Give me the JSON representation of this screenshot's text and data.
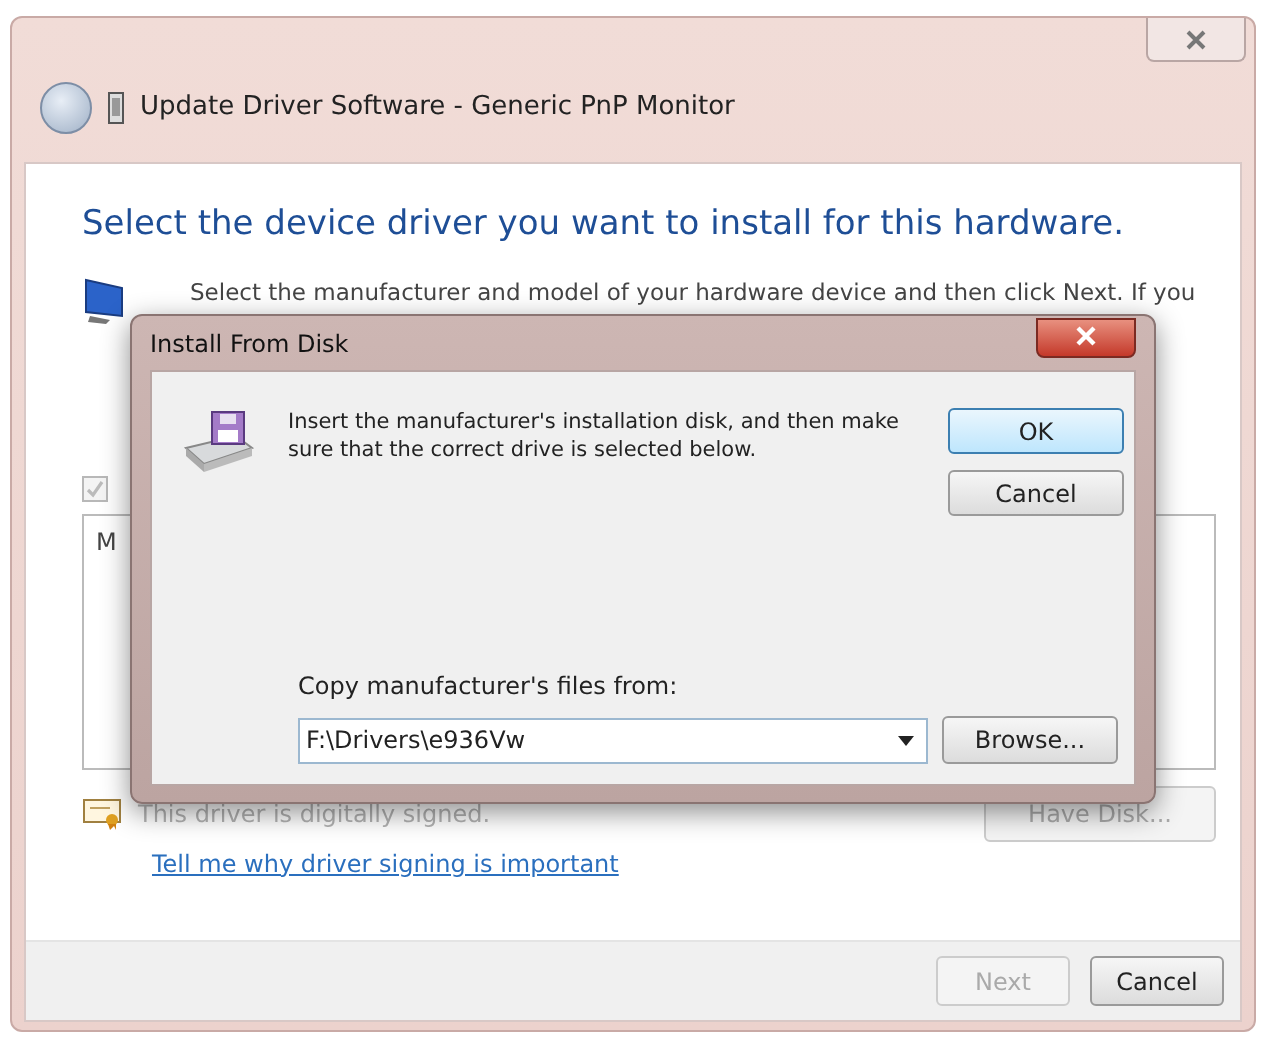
{
  "window": {
    "title": "Update Driver Software - Generic PnP Monitor"
  },
  "heading": "Select the device driver you want to install for this hardware.",
  "instruction": "Select the manufacturer and model of your hardware device and then click Next. If you",
  "show_compatible": {
    "checked": true,
    "disabled": true
  },
  "list": {
    "column_1": "M"
  },
  "signing": {
    "text": "This driver is digitally signed.",
    "disabled": true
  },
  "link": "Tell me why driver signing is important",
  "have_disk": {
    "label": "Have Disk...",
    "disabled": true
  },
  "buttons": [
    {
      "label": "Next",
      "disabled": true
    },
    {
      "label": "Cancel",
      "disabled": false
    }
  ],
  "dialog": {
    "title": "Install From Disk",
    "message": "Insert the manufacturer's installation disk, and then make sure that the correct drive is selected below.",
    "buttons": [
      {
        "label": "OK",
        "default": true
      },
      {
        "label": "Cancel",
        "default": false
      }
    ],
    "path_label": "Copy manufacturer's files from:",
    "path_value": "F:\\Drivers\\e936Vw",
    "browse": "Browse..."
  }
}
